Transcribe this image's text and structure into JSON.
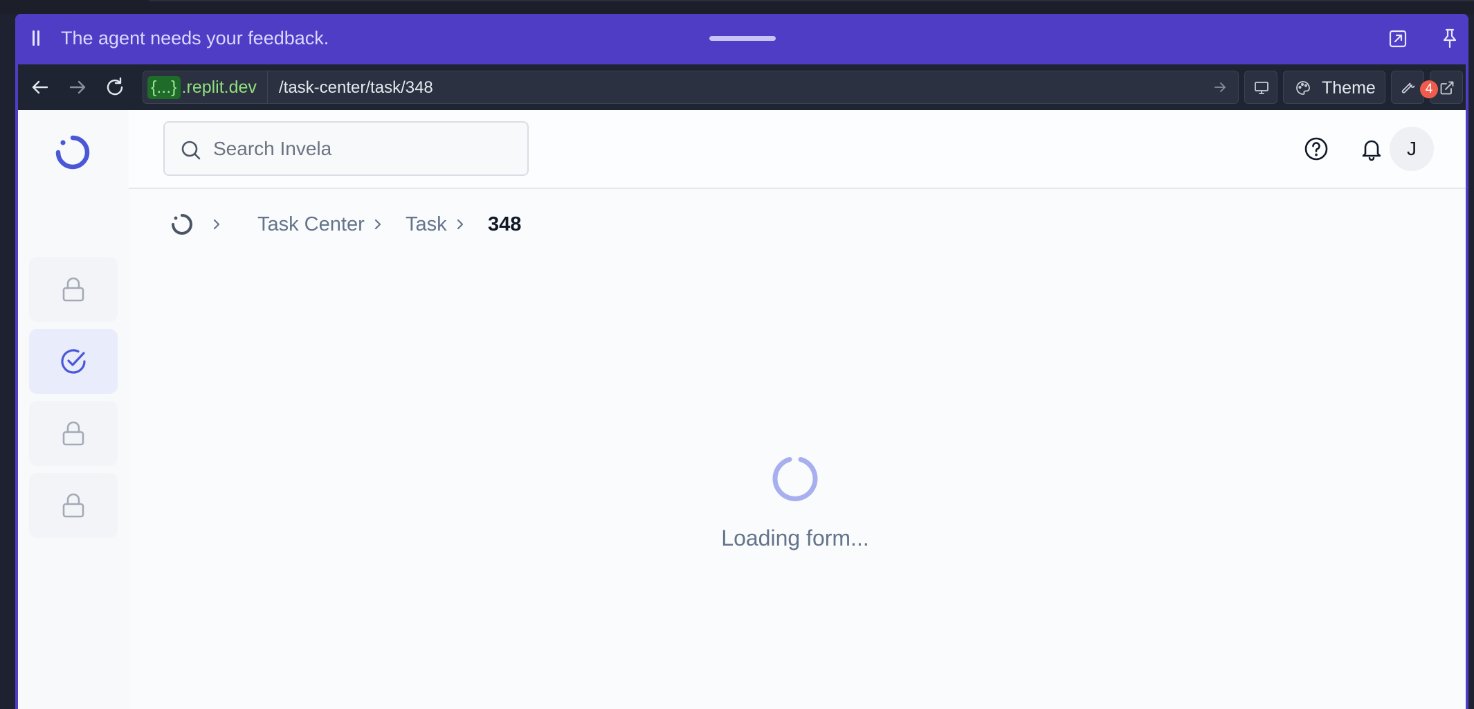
{
  "banner": {
    "message": "The agent needs your feedback."
  },
  "browser": {
    "domain_pill": "{...}",
    "domain_host": ".replit.dev",
    "path": "/task-center/task/348",
    "theme_label": "Theme",
    "devtools_badge": "4"
  },
  "search": {
    "placeholder": "Search Invela"
  },
  "user": {
    "avatar_initial": "J"
  },
  "breadcrumb": {
    "items": [
      "Task Center",
      "Task"
    ],
    "current": "348"
  },
  "main": {
    "loading_text": "Loading form..."
  },
  "sidebar": {
    "items": [
      {
        "icon": "lock-icon",
        "locked": true,
        "active": false
      },
      {
        "icon": "task-check-icon",
        "locked": false,
        "active": true
      },
      {
        "icon": "lock-icon",
        "locked": true,
        "active": false
      },
      {
        "icon": "lock-icon",
        "locked": true,
        "active": false
      }
    ]
  },
  "colors": {
    "banner": "#4f3dc6",
    "accent": "#5b6ee1",
    "badge": "#ef5b4d",
    "domain_green": "#8fe07d"
  }
}
